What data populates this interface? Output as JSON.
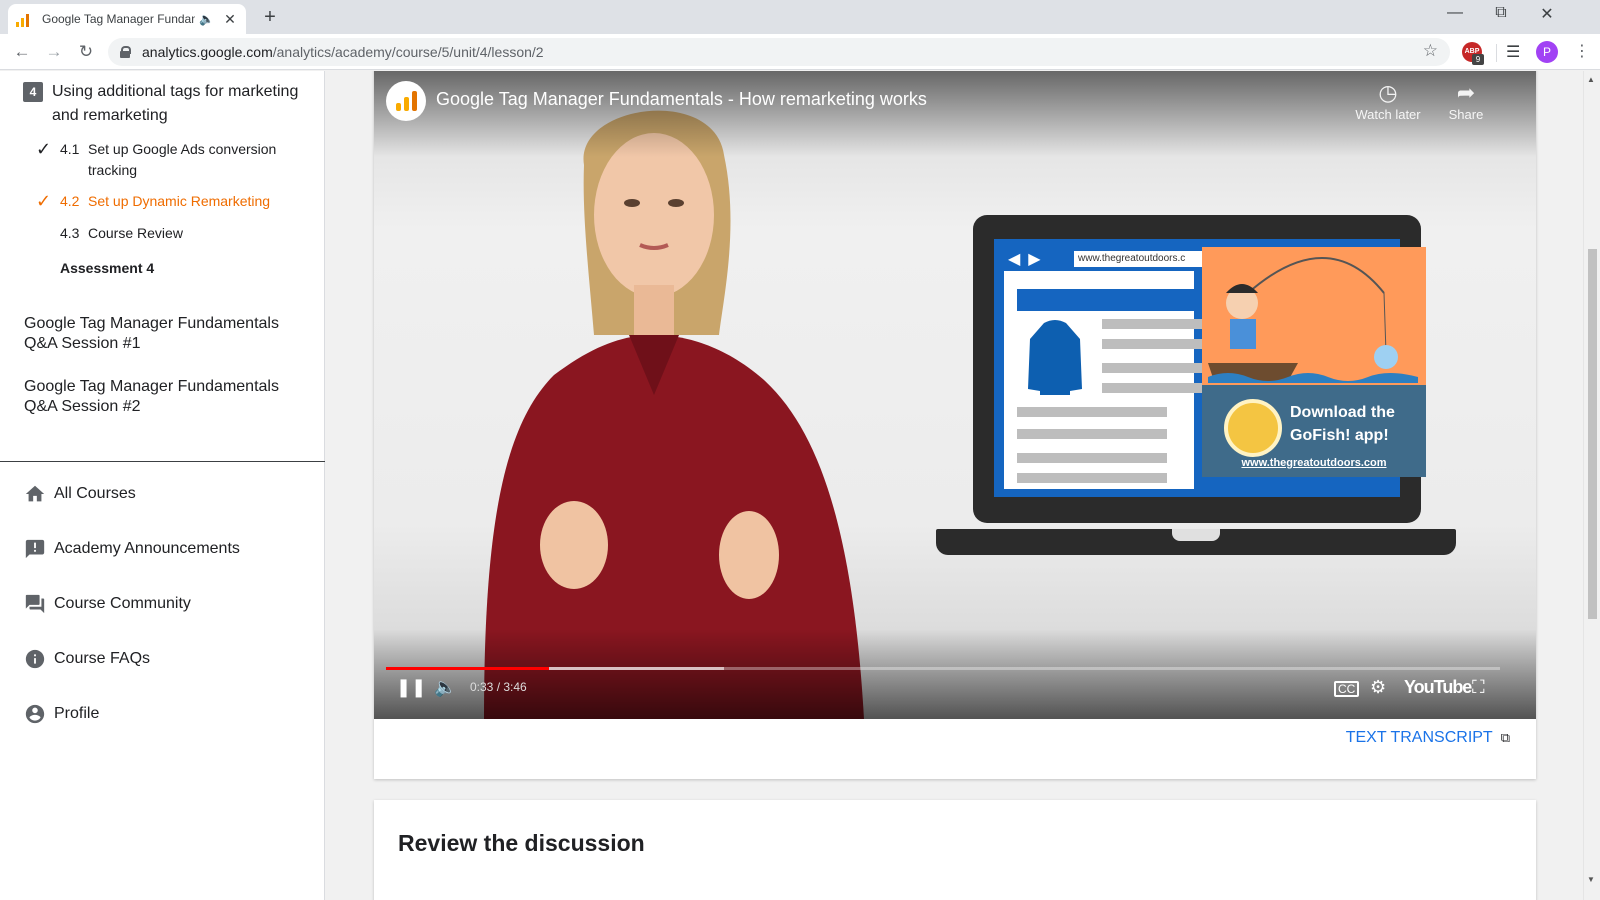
{
  "browser": {
    "tab_title": "Google Tag Manager Fundam",
    "audio_icon": "speaker-icon",
    "close": "✕",
    "newtab": "+",
    "url_host": "analytics.google.com",
    "url_path": "/analytics/academy/course/5/unit/4/lesson/2",
    "ext_badge_count": "9",
    "profile_initial": "P"
  },
  "sidebar": {
    "unit_number": "4",
    "unit_title": "Using additional tags for marketing and remarketing",
    "lessons": [
      {
        "num": "4.1",
        "label": "Set up Google Ads conversion tracking",
        "completed": true,
        "active": false
      },
      {
        "num": "4.2",
        "label": "Set up Dynamic Remarketing",
        "completed": true,
        "active": true
      },
      {
        "num": "4.3",
        "label": "Course Review",
        "completed": false,
        "active": false
      }
    ],
    "assessment": "Assessment 4",
    "qa_sessions": [
      "Google Tag Manager Fundamentals Q&A Session #1",
      "Google Tag Manager Fundamentals Q&A Session #2"
    ],
    "links": [
      {
        "label": "All Courses",
        "icon": "home-icon"
      },
      {
        "label": "Academy Announcements",
        "icon": "announcement-icon"
      },
      {
        "label": "Course Community",
        "icon": "forum-icon"
      },
      {
        "label": "Course FAQs",
        "icon": "info-icon"
      },
      {
        "label": "Profile",
        "icon": "account-circle-icon"
      }
    ]
  },
  "video": {
    "title": "Google Tag Manager Fundamentals - How remarketing works",
    "watch_later": "Watch later",
    "share": "Share",
    "current_time": "0:33",
    "duration": "3:46",
    "time_display": "0:33 / 3:46",
    "played_fraction": 0.146,
    "buffered_fraction": 0.303,
    "youtube_wordmark": "YouTube",
    "laptop_url": "www.thegreatoutdoors.c",
    "ad_headline": "Download the GoFish! app!",
    "ad_url": "www.thegreatoutdoors.com"
  },
  "transcript_label": "TEXT TRANSCRIPT",
  "discussion_heading": "Review the discussion",
  "colors": {
    "accent_active": "#ef6c00",
    "link_blue": "#1a73e8",
    "progress_red": "#ff0000"
  }
}
